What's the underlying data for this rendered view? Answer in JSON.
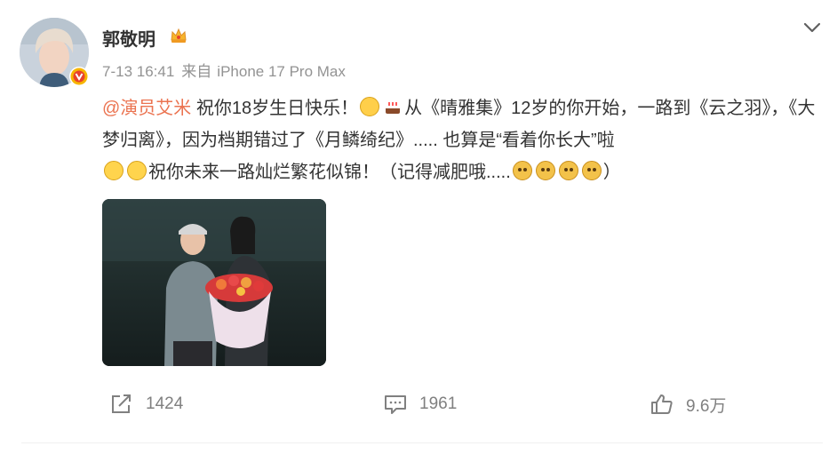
{
  "post": {
    "author": "郭敬明",
    "time": "7-13 16:41",
    "source_prefix": "来自",
    "device": "iPhone 17 Pro Max",
    "text": {
      "mention": "@演员艾米",
      "seg1": " 祝你18岁生日快乐！",
      "seg2": "从《晴雅集》12岁的你开始，一路到《云之羽》，《大梦归离》，因为档期错过了《月鳞绮纪》..... 也算是“看着你长大”啦",
      "seg3": "祝你未来一路灿烂繁花似锦！（记得减肥哦.....",
      "seg4": "）"
    },
    "icons": {
      "crown": "crown-icon",
      "verified": "verified-badge-icon",
      "more": "chevron-down-icon",
      "emoji_1": "shocked-face-emoji",
      "emoji_2": "birthday-cake-emoji",
      "emoji_3": "thinking-face-emoji",
      "emoji_4": "doge-emoji"
    }
  },
  "actions": {
    "repost_count": "1424",
    "comment_count": "1961",
    "like_count": "9.6万"
  },
  "colors": {
    "accent": "#eb7350",
    "text": "#333333",
    "meta": "#939393",
    "action": "#808080"
  }
}
